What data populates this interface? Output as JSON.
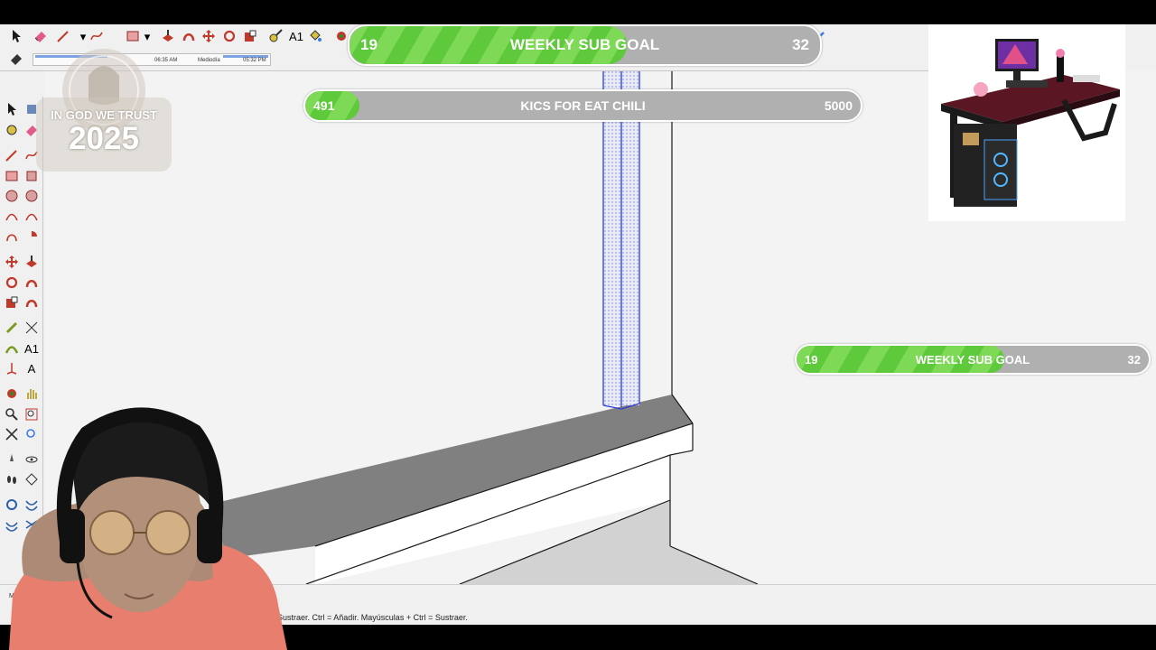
{
  "overlays": {
    "weekly_goal_top": {
      "current": "19",
      "title": "WEEKLY SUB GOAL",
      "target": "32",
      "progress": 0.59
    },
    "kics_goal": {
      "current": "491",
      "title": "KICS FOR EAT CHILI",
      "target": "5000",
      "progress": 0.098
    },
    "weekly_goal_right": {
      "current": "19",
      "title": "WEEKLY SUB GOAL",
      "target": "32",
      "progress": 0.59
    },
    "seal": {
      "line1": "IN GOD WE TRUST",
      "line2": "2025"
    }
  },
  "toolbar": {
    "time_strip": {
      "start": "06:35 AM",
      "mid": "Mediodía",
      "end": "05:32 PM"
    }
  },
  "statusbar": {
    "hint": "Sustraer. Ctrl = Añadir. Mayúsculas + Ctrl = Sustraer.",
    "measure_label": "Medid"
  },
  "colors": {
    "goal_fill": "#7ed957",
    "goal_track": "#b0b0b0",
    "edge_blue": "#2a3cd6",
    "floor_gray": "#808080"
  }
}
